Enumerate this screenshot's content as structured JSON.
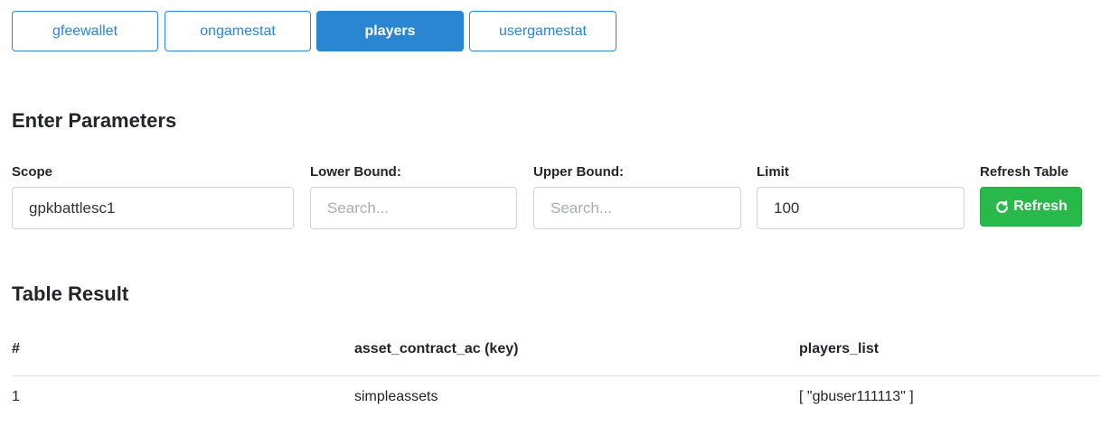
{
  "tabs": [
    {
      "label": "gfeewallet",
      "active": false
    },
    {
      "label": "ongamestat",
      "active": false
    },
    {
      "label": "players",
      "active": true
    },
    {
      "label": "usergamestat",
      "active": false
    }
  ],
  "params": {
    "heading": "Enter Parameters",
    "scope": {
      "label": "Scope",
      "value": "gpkbattlesc1"
    },
    "lower": {
      "label": "Lower Bound:",
      "placeholder": "Search..."
    },
    "upper": {
      "label": "Upper Bound:",
      "placeholder": "Search..."
    },
    "limit": {
      "label": "Limit",
      "value": "100"
    },
    "refresh": {
      "label": "Refresh Table",
      "button": "Refresh",
      "icon": "refresh-icon"
    }
  },
  "result": {
    "heading": "Table Result",
    "columns": [
      "#",
      "asset_contract_ac (key)",
      "players_list"
    ],
    "rows": [
      [
        "1",
        "simpleassets",
        "[ \"gbuser111113\" ]"
      ]
    ]
  },
  "colors": {
    "accent": "#2a86d3",
    "success": "#28b94a"
  }
}
